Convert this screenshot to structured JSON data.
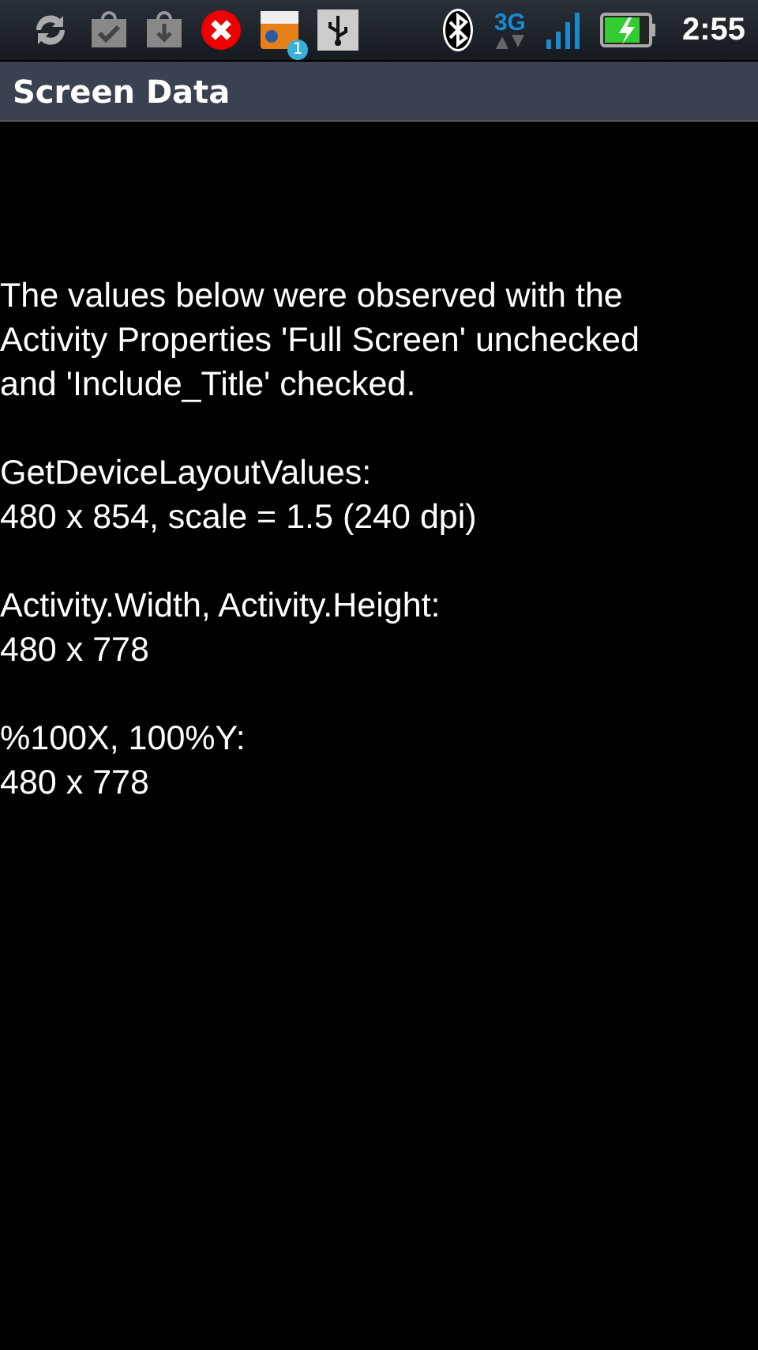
{
  "status_bar": {
    "notification_badge": "1",
    "network": "3G",
    "time": "2:55"
  },
  "title_bar": {
    "title": "Screen Data"
  },
  "paragraphs": [
    {
      "lines": [
        "The values below were observed with the",
        "Activity Properties 'Full Screen' unchecked",
        "and 'Include_Title' checked."
      ]
    },
    {
      "lines": [
        "GetDeviceLayoutValues:",
        "480 x 854, scale = 1.5 (240 dpi)"
      ]
    },
    {
      "lines": [
        "Activity.Width, Activity.Height:",
        "480 x 778"
      ]
    },
    {
      "lines": [
        "%100X, 100%Y:",
        "480 x 778"
      ]
    }
  ]
}
